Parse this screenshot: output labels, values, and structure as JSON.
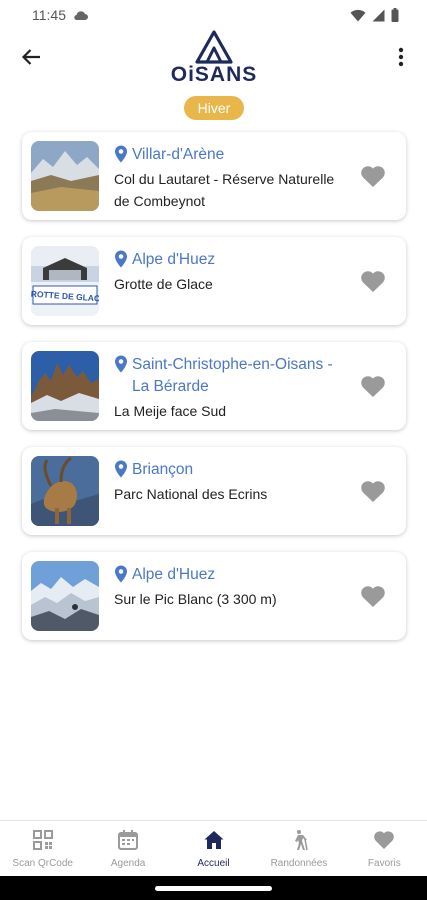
{
  "status_bar": {
    "time": "11:45"
  },
  "header": {
    "logo_text": "OiSANS",
    "season_badge": "Hiver",
    "accent_color": "#1f2a5c",
    "badge_color": "#e8b64a"
  },
  "places": [
    {
      "location": "Villar-d'Arène",
      "title": "Col du Lautaret - Réserve Naturelle de Combeynot",
      "favorite": false
    },
    {
      "location": "Alpe d'Huez",
      "title": "Grotte de Glace",
      "favorite": false
    },
    {
      "location": "Saint-Christophe-en-Oisans - La Bérarde",
      "title": "La Meije face Sud",
      "favorite": false
    },
    {
      "location": "Briançon",
      "title": "Parc National des Ecrins",
      "favorite": false
    },
    {
      "location": "Alpe d'Huez",
      "title": "Sur le Pic Blanc (3 300 m)",
      "favorite": false
    }
  ],
  "thumb_sign_text": "GROTTE DE GLACE",
  "bottom_nav": [
    {
      "label": "Scan QrCode",
      "icon": "qr-code-icon",
      "active": false
    },
    {
      "label": "Agenda",
      "icon": "calendar-icon",
      "active": false
    },
    {
      "label": "Accueil",
      "icon": "home-icon",
      "active": true
    },
    {
      "label": "Randonnées",
      "icon": "hiker-icon",
      "active": false
    },
    {
      "label": "Favoris",
      "icon": "heart-icon",
      "active": false
    }
  ],
  "colors": {
    "link_blue": "#4a78c4",
    "heart_gray": "#9a9a9a"
  }
}
